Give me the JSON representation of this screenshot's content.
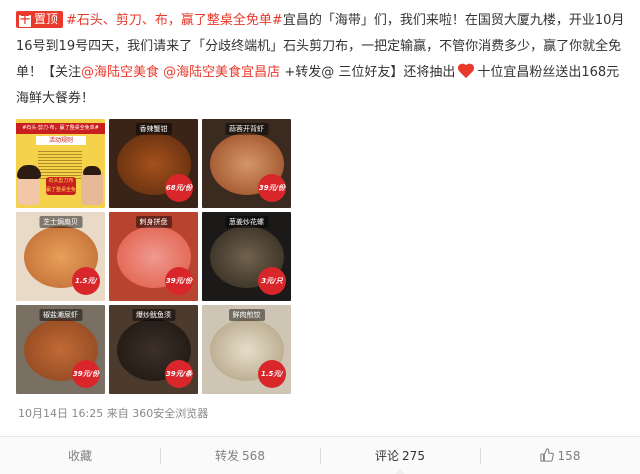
{
  "post": {
    "pin_label": "置顶",
    "pin_glyph": "干",
    "hashtag": "#石头、剪刀、布，赢了整桌全免单#",
    "text_a": "宜昌的「海带」们，我们来啦！在国贸大厦九楼，开业10月16号到19号四天，我们请来了「分歧终端机」石头剪刀布，一把定输赢，不管你消费多少，赢了你就全免单！【关注",
    "mention_1": "@海陆空美食",
    "text_b": " ",
    "mention_2": "@海陆空美食宜昌店",
    "text_c": " +转发@ 三位好友】还将抽出",
    "text_d": "十位宜昌粉丝送出168元海鲜大餐券！"
  },
  "photos": [
    {
      "tag": "",
      "price": "",
      "poster": {
        "banner": "#石头·剪刀·布，赢了整桌全免单#",
        "sub": "活动规则",
        "badge": "石头剪刀布 赢了整桌全免单"
      }
    },
    {
      "tag": "香辣蟹钳",
      "price": "68元/份"
    },
    {
      "tag": "蒜蓉开背虾",
      "price": "39元/份"
    },
    {
      "tag": "芝士焗扇贝",
      "price": "1.5元/只"
    },
    {
      "tag": "刺身拼盘",
      "price": "39元/份"
    },
    {
      "tag": "葱姜炒花螺",
      "price": "3元/只"
    },
    {
      "tag": "椒盐濑尿虾",
      "price": "39元/份"
    },
    {
      "tag": "爆炒鱿鱼须",
      "price": "39元/条"
    },
    {
      "tag": "鲜肉煎饺",
      "price": "1.5元/只"
    }
  ],
  "meta": {
    "date": "10月14日",
    "time": "16:25",
    "source": "来自 360安全浏览器"
  },
  "actions": {
    "favorite": "收藏",
    "repost_label": "转发",
    "repost_count": "568",
    "comment_label": "评论",
    "comment_count": "275",
    "like_count": "158"
  },
  "colors": {
    "accent": "#e8392b",
    "price_badge": "#d9262b",
    "meta_text": "#888888"
  }
}
